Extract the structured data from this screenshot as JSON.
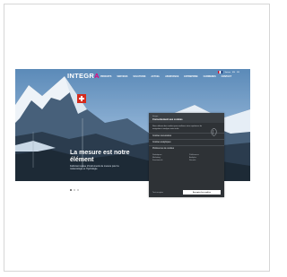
{
  "brand": {
    "name_main": "INTEGR",
    "name_accent": "A"
  },
  "nav": {
    "items": [
      "PRODUITS",
      "SERVICES",
      "SOLUTIONS",
      "ACTUEL",
      "ASSISTANCE",
      "ENTREPRISE",
      "CARRIERES",
      "CONTACT"
    ]
  },
  "topbar": {
    "links": [
      "Suisse",
      "EN",
      "FR"
    ]
  },
  "hero": {
    "title": "La mesure est notre élément",
    "subtitle": "Fabricant suisse d'instruments de mesure pour la météorologie et l'hydrologie"
  },
  "cookie_panel": {
    "small_heading": "Integra",
    "title": "Consentement aux cookies",
    "body": "Nous utilisons des cookies pour améliorer votre expérience de navigation et analyser notre trafic.",
    "rows": [
      "Cookies nécessaires",
      "Cookies analytiques",
      "Préférences de cookies"
    ],
    "col_left": [
      "Statistiques",
      "Marketing",
      "Fonctionnels"
    ],
    "col_right": [
      "Préférences",
      "Analytics",
      "Sécurité"
    ],
    "bottom_text": "Tout accepter",
    "accept_label": "Accepter les cookies"
  },
  "carousel": {
    "count": 3,
    "active": 0
  },
  "colors": {
    "accent": "#e6007e",
    "panel": "#2e3236",
    "sky": "#86abd0"
  }
}
